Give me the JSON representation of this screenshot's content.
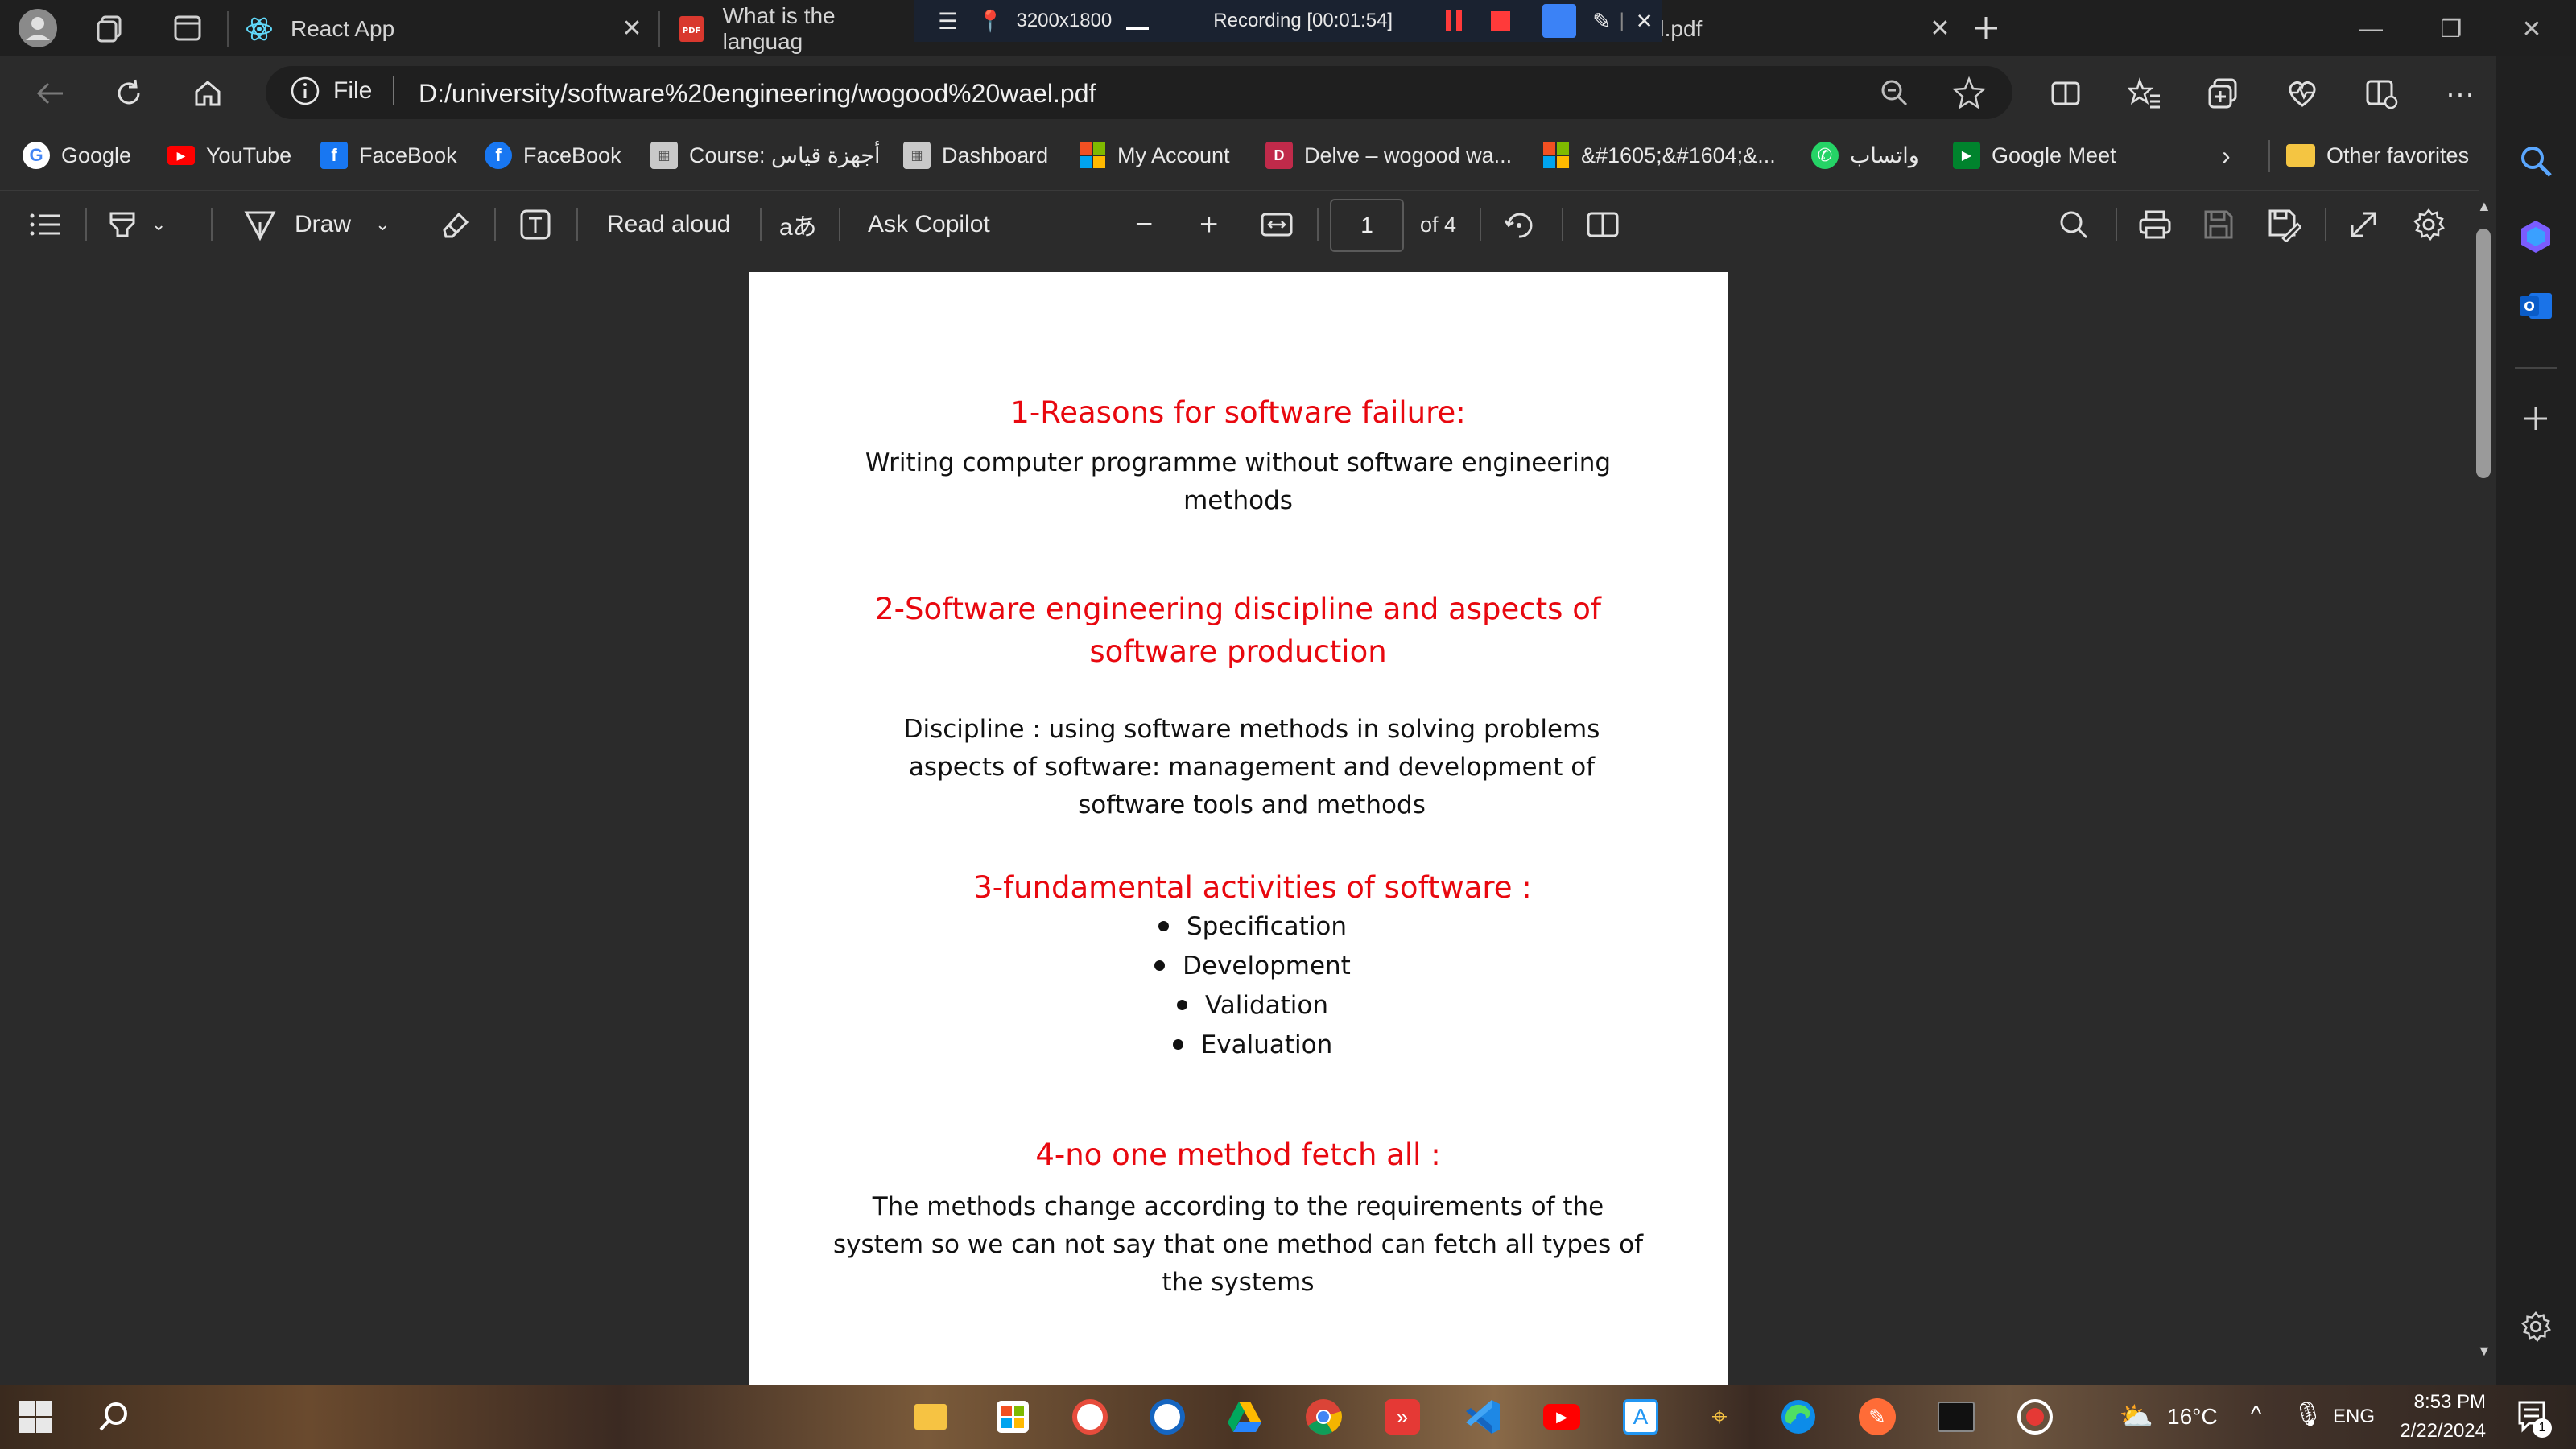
{
  "tabs": [
    {
      "title": "React App"
    },
    {
      "title": "What is the languag"
    },
    {
      "title": "wael.pdf"
    }
  ],
  "recording": {
    "size": "3200x1800",
    "status": "Recording [00:01:54]"
  },
  "address": {
    "scheme_label": "File",
    "url": "D:/university/software%20engineering/wogood%20wael.pdf"
  },
  "favorites": [
    {
      "label": "Google"
    },
    {
      "label": "YouTube"
    },
    {
      "label": "FaceBook"
    },
    {
      "label": "FaceBook"
    },
    {
      "label": "Course: أجهزة قياس"
    },
    {
      "label": "Dashboard"
    },
    {
      "label": "My Account"
    },
    {
      "label": "Delve – wogood wa..."
    },
    {
      "label": "&#1605;&#1604;&..."
    },
    {
      "label": "واتساب"
    },
    {
      "label": "Google Meet"
    },
    {
      "label": "Other favorites"
    }
  ],
  "pdf_toolbar": {
    "draw_label": "Draw",
    "read_aloud_label": "Read aloud",
    "translate_glyph": "aあ",
    "copilot_label": "Ask Copilot",
    "page_current": "1",
    "page_total": "of 4"
  },
  "document": {
    "sections": [
      {
        "heading": "1-Reasons for software failure:",
        "body": [
          "Writing computer programme without software engineering",
          "methods"
        ]
      },
      {
        "heading_lines": [
          "2-Software engineering discipline and aspects of",
          "software production"
        ],
        "body": [
          "Discipline : using software methods in solving problems",
          "aspects of software: management and development of",
          "software tools and methods"
        ]
      },
      {
        "heading": "3-fundamental activities of software :",
        "bullets": [
          "Specification",
          "Development",
          "Validation",
          "Evaluation"
        ]
      },
      {
        "heading": "4-no one method fetch all :",
        "body": [
          "The methods change according to the requirements of the",
          "system so we can not say that one method can fetch all types of",
          "the systems"
        ]
      }
    ]
  },
  "taskbar": {
    "temperature": "16°C",
    "language": "ENG",
    "time": "8:53 PM",
    "date": "2/22/2024",
    "notification_count": "1"
  },
  "colors": {
    "heading_red": "#e8080f",
    "browser_dark": "#2b2b2b",
    "accent_blue": "#3b82f6"
  },
  "icons": [
    "profile-icon",
    "workspaces-icon",
    "tab-actions-icon",
    "react-icon",
    "pdf-icon",
    "back-icon",
    "refresh-icon",
    "home-icon",
    "info-icon",
    "zoom-icon",
    "star-icon",
    "split-screen-icon",
    "favorites-icon",
    "collections-icon",
    "performance-icon",
    "browser-essentials-icon",
    "more-icon",
    "copilot-icon",
    "contents-icon",
    "highlight-icon",
    "draw-icon",
    "eraser-icon",
    "text-icon",
    "fit-width-icon",
    "rotate-icon",
    "page-view-icon",
    "search-icon",
    "print-icon",
    "save-icon",
    "save-as-icon",
    "fullscreen-icon",
    "settings-icon"
  ]
}
